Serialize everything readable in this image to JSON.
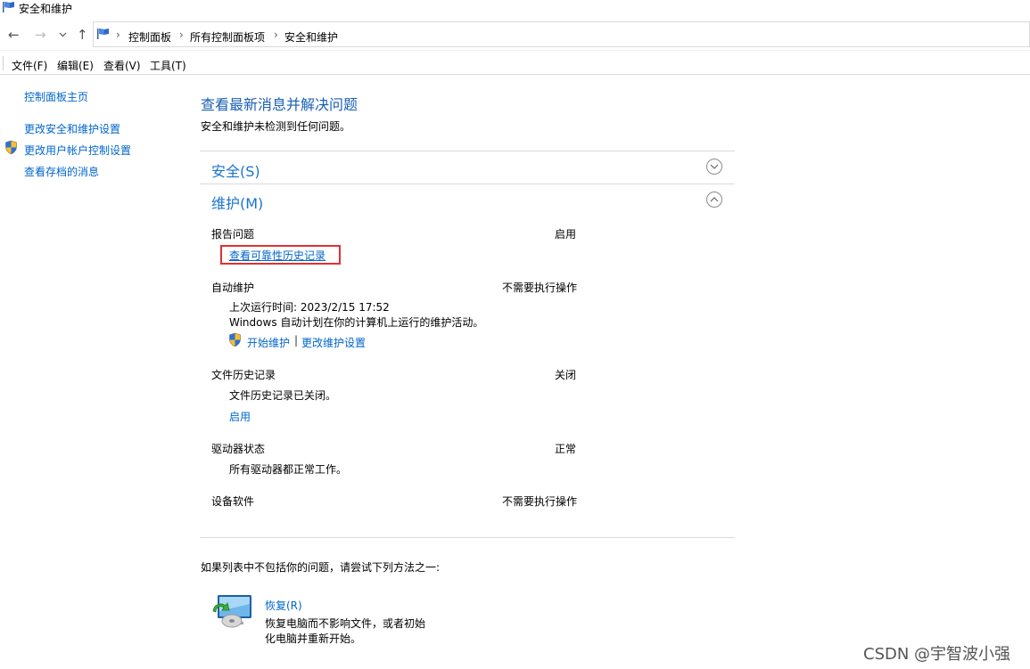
{
  "window": {
    "title": "安全和维护"
  },
  "address": {
    "crumbs": [
      "控制面板",
      "所有控制面板项",
      "安全和维护"
    ]
  },
  "menu": [
    "文件(F)",
    "编辑(E)",
    "查看(V)",
    "工具(T)"
  ],
  "sidebar": {
    "home": "控制面板主页",
    "items": [
      "更改安全和维护设置",
      "更改用户帐户控制设置",
      "查看存档的消息"
    ]
  },
  "main": {
    "heading": "查看最新消息并解决问题",
    "subheading": "安全和维护未检测到任何问题。",
    "security_section": "安全(S)",
    "maintenance_section": "维护(M)",
    "items": {
      "report": {
        "label": "报告问题",
        "status": "启用",
        "link": "查看可靠性历史记录"
      },
      "auto": {
        "label": "自动维护",
        "status": "不需要执行操作",
        "last_run": "上次运行时间: 2023/2/15 17:52",
        "desc": "Windows 自动计划在你的计算机上运行的维护活动。",
        "start_link": "开始维护",
        "sep": "|",
        "change_link": "更改维护设置"
      },
      "file_history": {
        "label": "文件历史记录",
        "status": "关闭",
        "desc": "文件历史记录已关闭。",
        "link": "启用"
      },
      "drive": {
        "label": "驱动器状态",
        "status": "正常",
        "desc": "所有驱动器都正常工作。"
      },
      "device": {
        "label": "设备软件",
        "status": "不需要执行操作"
      }
    },
    "footer_prompt": "如果列表中不包括你的问题，请尝试下列方法之一:",
    "recovery": {
      "link": "恢复(R)",
      "desc1": "恢复电脑而不影响文件，或者初始",
      "desc2": "化电脑并重新开始。"
    }
  },
  "watermark": "CSDN @宇智波小强",
  "colors": {
    "link": "#0066cc",
    "section": "#1a73d1",
    "highlight": "#e03030"
  }
}
